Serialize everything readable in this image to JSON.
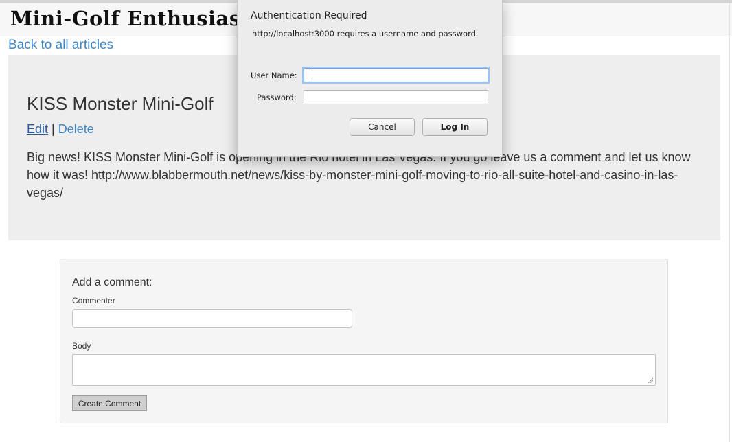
{
  "header": {
    "site_title": "Mini-Golf Enthusiasts"
  },
  "nav": {
    "back_link": "Back to all articles"
  },
  "article": {
    "title": "KISS Monster Mini-Golf",
    "edit_link": "Edit",
    "separator": "|",
    "delete_link": "Delete",
    "body": "Big news! KISS Monster Mini-Golf is opening in the Rio hotel in Las Vegas. If you go leave us a comment and let us know how it was! http://www.blabbermouth.net/news/kiss-by-monster-mini-golf-moving-to-rio-all-suite-hotel-and-casino-in-las-vegas/"
  },
  "comment_form": {
    "heading": "Add a comment:",
    "commenter_label": "Commenter",
    "commenter_value": "",
    "body_label": "Body",
    "body_value": "",
    "submit_label": "Create Comment"
  },
  "auth_dialog": {
    "title": "Authentication Required",
    "message": "http://localhost:3000 requires a username and password.",
    "username_label": "User Name:",
    "username_value": "",
    "password_label": "Password:",
    "password_value": "",
    "cancel_label": "Cancel",
    "login_label": "Log In"
  }
}
